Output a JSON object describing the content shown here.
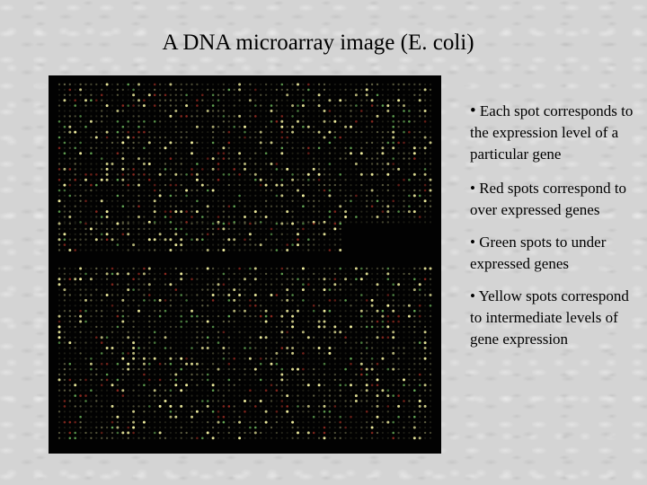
{
  "slide": {
    "title": "A DNA microarray image (E. coli)",
    "image": {
      "description": "DNA microarray scan with grid of red, green, and yellow spots on black background",
      "spot_colors": {
        "red": "#c0392b",
        "green": "#7fd36a",
        "yellow": "#f2f0a0",
        "background": "#020202"
      }
    },
    "bullets": [
      {
        "marker": "•",
        "text": "Each spot corresponds to the expression level of a particular gene"
      },
      {
        "marker": "•",
        "text": "Red spots correspond to over expressed genes"
      },
      {
        "marker": "•",
        "text": "Green spots to under expressed genes"
      },
      {
        "marker": "•",
        "text": "Yellow spots correspond to intermediate levels of gene expression"
      }
    ]
  }
}
